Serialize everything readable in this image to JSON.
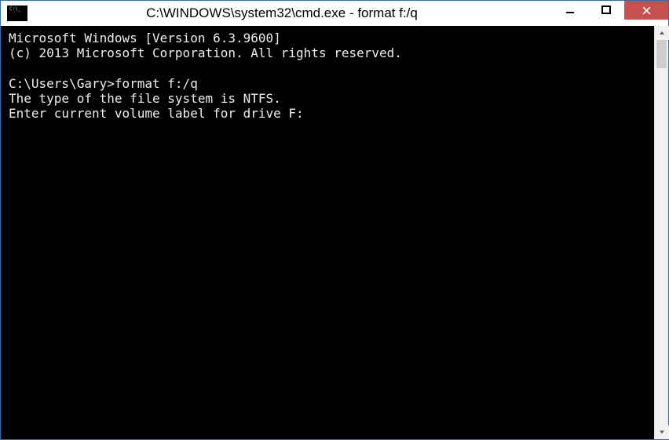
{
  "window": {
    "title": "C:\\WINDOWS\\system32\\cmd.exe - format  f:/q",
    "icon_name": "cmd-icon"
  },
  "terminal": {
    "line1": "Microsoft Windows [Version 6.3.9600]",
    "line2": "(c) 2013 Microsoft Corporation. All rights reserved.",
    "blank1": "",
    "prompt_path": "C:\\Users\\Gary>",
    "command": "format f:/q",
    "line4": "The type of the file system is NTFS.",
    "line5": "Enter current volume label for drive F: "
  }
}
